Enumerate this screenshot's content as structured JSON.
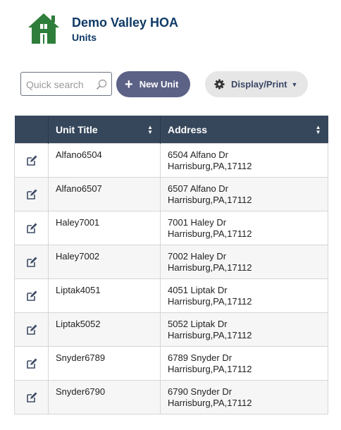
{
  "header": {
    "org_name": "Demo Valley HOA",
    "page_title": "Units"
  },
  "toolbar": {
    "search_placeholder": "Quick search",
    "new_unit_label": "New Unit",
    "display_print_label": "Display/Print"
  },
  "table": {
    "columns": [
      "Unit Title",
      "Address"
    ],
    "rows": [
      {
        "title": "Alfano6504",
        "address_line1": "6504 Alfano Dr",
        "address_line2": "Harrisburg,PA,17112"
      },
      {
        "title": "Alfano6507",
        "address_line1": "6507 Alfano Dr",
        "address_line2": "Harrisburg,PA,17112"
      },
      {
        "title": "Haley7001",
        "address_line1": "7001 Haley Dr",
        "address_line2": "Harrisburg,PA,17112"
      },
      {
        "title": "Haley7002",
        "address_line1": "7002 Haley Dr",
        "address_line2": "Harrisburg,PA,17112"
      },
      {
        "title": "Liptak4051",
        "address_line1": "4051 Liptak Dr",
        "address_line2": "Harrisburg,PA,17112"
      },
      {
        "title": "Liptak5052",
        "address_line1": "5052 Liptak Dr",
        "address_line2": "Harrisburg,PA,17112"
      },
      {
        "title": "Snyder6789",
        "address_line1": "6789 Snyder Dr",
        "address_line2": "Harrisburg,PA,17112"
      },
      {
        "title": "Snyder6790",
        "address_line1": "6790 Snyder Dr",
        "address_line2": "Harrisburg,PA,17112"
      }
    ]
  },
  "icons": {
    "logo": "house-logo-icon",
    "search": "search-icon",
    "new": "plus-icon",
    "display": "gear-icon",
    "dropdown": "caret-down-icon",
    "edit": "edit-icon",
    "sort": "sort-icon"
  },
  "colors": {
    "brand_text": "#0e3a66",
    "logo_green": "#2e7d3a",
    "header_bg": "#36475c",
    "new_button": "#5c6286",
    "display_button": "#e6e6e6"
  }
}
